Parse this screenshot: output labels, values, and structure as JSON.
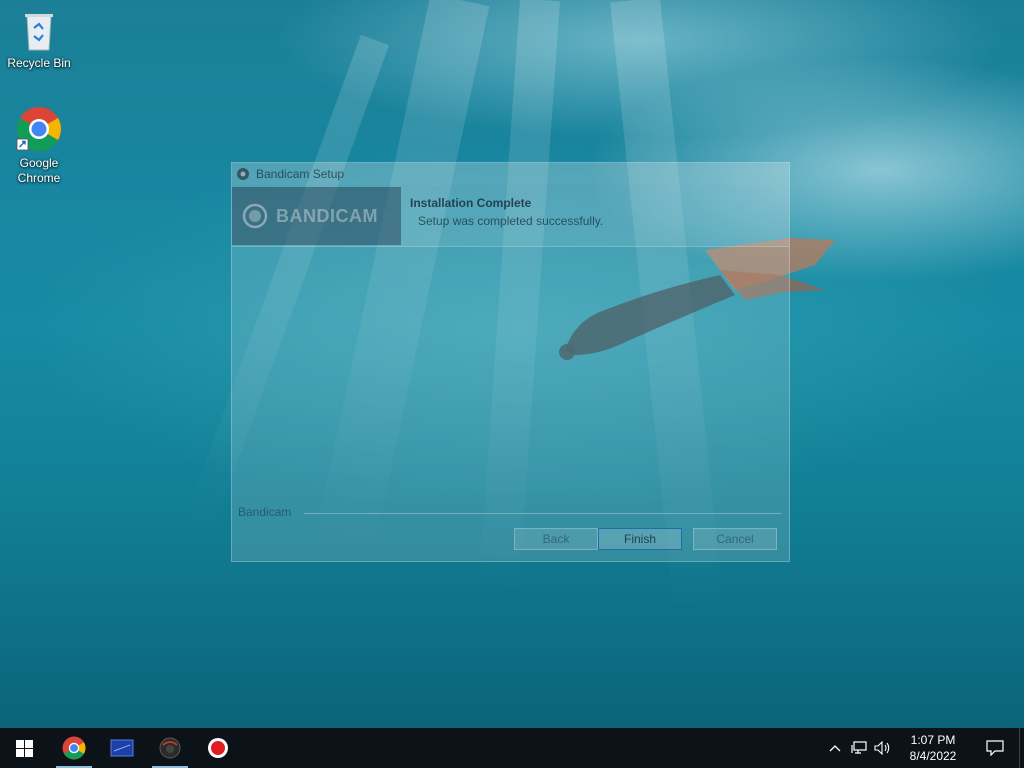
{
  "desktop": {
    "icons": [
      {
        "label": "Recycle Bin",
        "icon": "recycle-bin-icon"
      },
      {
        "label": "Google Chrome",
        "icon": "chrome-icon"
      }
    ]
  },
  "dialog": {
    "title": "Bandicam Setup",
    "brand": "BANDICAM",
    "header_title": "Installation Complete",
    "header_subtitle": "Setup was completed successfully.",
    "footer_label": "Bandicam",
    "buttons": {
      "back": "Back",
      "finish": "Finish",
      "cancel": "Cancel"
    }
  },
  "taskbar": {
    "apps": [
      "start-icon",
      "chrome-icon",
      "display-icon",
      "bandicam-icon",
      "record-icon"
    ],
    "clock": {
      "time": "1:07 PM",
      "date": "8/4/2022"
    },
    "accent": "#8fbfe0"
  }
}
